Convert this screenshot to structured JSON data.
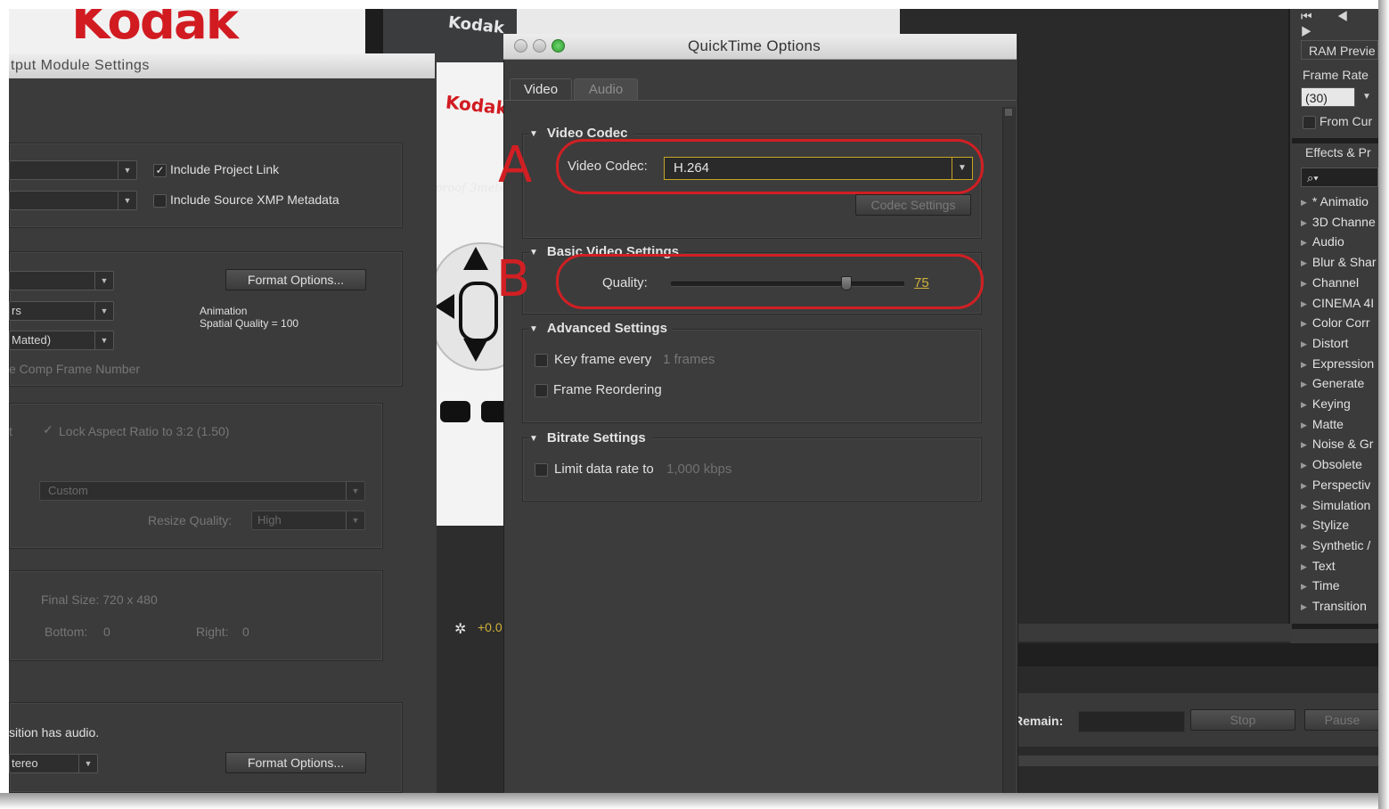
{
  "background_window": {
    "logo_text": "Kodak",
    "brand_text_top": "Kodak",
    "brand_text_red": "Kodak",
    "proof_text": "proof 3meters",
    "viewer_tool_icon": "✲",
    "viewer_exposure": "+0.0"
  },
  "output_module": {
    "title": "tput Module Settings",
    "include_project_link": "Include Project Link",
    "include_project_link_checked": true,
    "include_source_xmp": "Include Source XMP Metadata",
    "include_source_xmp_checked": false,
    "format_options_label": "Format Options...",
    "channels_value": "rs",
    "color_value": "Matted)",
    "format_info_line1": "Animation",
    "format_info_line2": "Spatial Quality = 100",
    "comp_frame_number": "e Comp Frame Number",
    "resize_prefix": "t",
    "lock_aspect": "Lock Aspect Ratio to 3:2 (1.50)",
    "resize_preset": "Custom",
    "resize_quality_label": "Resize Quality:",
    "resize_quality_value": "High",
    "final_size": "Final Size: 720 x 480",
    "bottom_label": "Bottom:",
    "bottom_value": "0",
    "right_label": "Right:",
    "right_value": "0",
    "audio_note": "sition has audio.",
    "audio_channels": "tereo",
    "audio_format_options_label": "Format Options..."
  },
  "quicktime": {
    "title": "QuickTime Options",
    "tabs": [
      "Video",
      "Audio"
    ],
    "active_tab": "Video",
    "video_codec_section": "Video Codec",
    "video_codec_label": "Video Codec:",
    "video_codec_value": "H.264",
    "codec_settings_label": "Codec Settings",
    "basic_video_section": "Basic Video Settings",
    "quality_label": "Quality:",
    "quality_value": "75",
    "quality_fraction": 0.75,
    "advanced_section": "Advanced Settings",
    "key_frame_label": "Key frame every",
    "key_frame_value": "1 frames",
    "frame_reordering_label": "Frame Reordering",
    "bitrate_section": "Bitrate Settings",
    "limit_rate_label": "Limit data rate to",
    "limit_rate_value": "1,000 kbps"
  },
  "annotations": {
    "a": "A",
    "b": "B",
    "color": "#d11f23"
  },
  "right_panel": {
    "transport_icons": "⏮ ◀ ▶",
    "ram_preview": "RAM Previe",
    "frame_rate_label": "Frame Rate",
    "frame_rate_value": "(30)",
    "from_current": "From Cur",
    "effects_title": "Effects & Pr",
    "search_icon": "⌕▾",
    "effects": [
      "* Animatio",
      "3D Channe",
      "Audio",
      "Blur & Shar",
      "Channel",
      "CINEMA 4I",
      "Color Corr",
      "Distort",
      "Expression",
      "Generate",
      "Keying",
      "Matte",
      "Noise & Gr",
      "Obsolete",
      "Perspectiv",
      "Simulation",
      "Stylize",
      "Synthetic /",
      "Text",
      "Time",
      "Transition"
    ]
  },
  "render_queue": {
    "remain_label": "Remain:",
    "stop_label": "Stop",
    "pause_label": "Pause"
  },
  "colors": {
    "accent_yellow": "#d1b239",
    "annotation_red": "#d11f23",
    "panel_bg": "#3c3c3c"
  }
}
